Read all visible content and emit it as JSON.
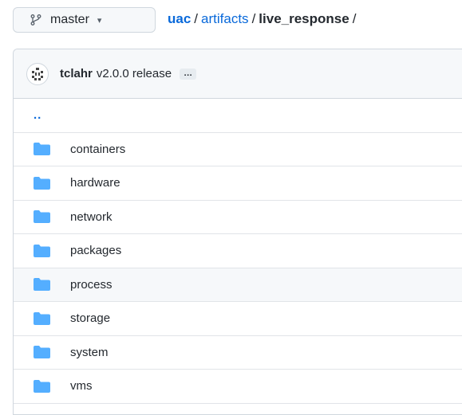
{
  "branch": {
    "icon": "git-branch-icon",
    "name": "master",
    "caret": "▾"
  },
  "breadcrumb": {
    "repo": "uac",
    "segment": "artifacts",
    "current": "live_response",
    "sep": "/",
    "trailing": "/"
  },
  "commit": {
    "avatar_icon": "avatar-icon",
    "author": "tclahr",
    "message": "v2.0.0 release",
    "ellipsis": "…"
  },
  "parent_dir": "..",
  "folder_icon_color": "#54aeff",
  "accent_color": "#0969da",
  "entries": [
    {
      "name": "containers",
      "icon": "folder-icon"
    },
    {
      "name": "hardware",
      "icon": "folder-icon"
    },
    {
      "name": "network",
      "icon": "folder-icon"
    },
    {
      "name": "packages",
      "icon": "folder-icon"
    },
    {
      "name": "process",
      "icon": "folder-icon"
    },
    {
      "name": "storage",
      "icon": "folder-icon"
    },
    {
      "name": "system",
      "icon": "folder-icon"
    },
    {
      "name": "vms",
      "icon": "folder-icon"
    }
  ]
}
